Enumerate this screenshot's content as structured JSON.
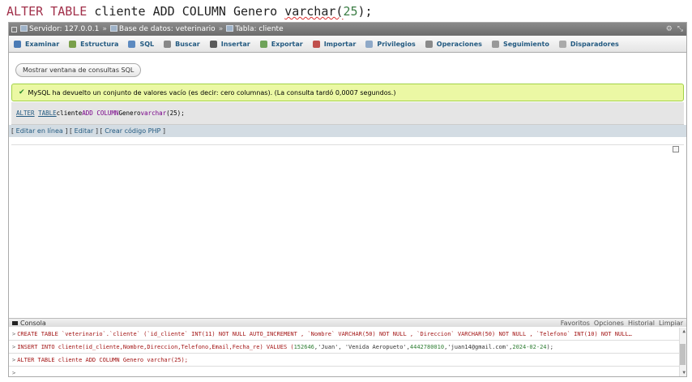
{
  "editor_line": {
    "kw1": "ALTER TABLE",
    "t1": " cliente ADD COLUMN Genero ",
    "t2": "varchar(",
    "num": "25",
    "t3": ");"
  },
  "breadcrumb": {
    "server": "Servidor: 127.0.0.1",
    "sep": "»",
    "database": "Base de datos: veterinario",
    "table": "Tabla: cliente",
    "right_icons": [
      "⚙",
      "⤡"
    ]
  },
  "tabs": [
    {
      "label": "Examinar",
      "icon": "browse-icon",
      "color": "#4b7bb5"
    },
    {
      "label": "Estructura",
      "icon": "structure-icon",
      "color": "#7aa04a"
    },
    {
      "label": "SQL",
      "icon": "sql-icon",
      "color": "#5d8ac0"
    },
    {
      "label": "Buscar",
      "icon": "search-icon",
      "color": "#888888"
    },
    {
      "label": "Insertar",
      "icon": "insert-icon",
      "color": "#5a5a5a"
    },
    {
      "label": "Exportar",
      "icon": "export-icon",
      "color": "#6fa35a"
    },
    {
      "label": "Importar",
      "icon": "import-icon",
      "color": "#c0504d"
    },
    {
      "label": "Privilegios",
      "icon": "privileges-icon",
      "color": "#8fa9c8"
    },
    {
      "label": "Operaciones",
      "icon": "operations-icon",
      "color": "#8a8a8a"
    },
    {
      "label": "Seguimiento",
      "icon": "tracking-icon",
      "color": "#999999"
    },
    {
      "label": "Disparadores",
      "icon": "triggers-icon",
      "color": "#aaaaaa"
    }
  ],
  "query_window_button": "Mostrar ventana de consultas SQL",
  "success_message": "MySQL ha devuelto un conjunto de valores vacío (es decir: cero columnas). (La consulta tardó 0,0007 segundos.)",
  "executed_sql": {
    "alter": "ALTER",
    "table": "TABLE",
    "rest1": " cliente ",
    "add": "ADD",
    "col": "COLUMN",
    "rest2": " Genero ",
    "type": "varchar",
    "args": "(25);"
  },
  "edit_links": {
    "inline": "Editar en línea",
    "edit": "Editar",
    "php": "Crear código PHP"
  },
  "console": {
    "label": "Consola",
    "links": [
      "Favoritos",
      "Opciones",
      "Historial",
      "Limpiar"
    ],
    "prompt": ">",
    "lines": {
      "l1": "CREATE TABLE `veterinario`.`cliente` (`id_cliente` INT(11) NOT NULL AUTO_INCREMENT , `Nombre` VARCHAR(50) NOT NULL , `Direccion` VARCHAR(50) NOT NULL , `Telefono` INT(10) NOT NULL…",
      "l2a": "INSERT INTO cliente(id_cliente,Nombre,Direccion,Telefono,Email,Fecha_re) VALUES (",
      "l2b": "152646",
      "l2c": ",'Juan', 'Venida Aeropueto', ",
      "l2d": "4442780010",
      "l2e": ",'juan14@gmail.com',",
      "l2f": "2024-02-24",
      "l2g": ");",
      "l3": "ALTER TABLE cliente ADD COLUMN Genero varchar(25);"
    }
  }
}
